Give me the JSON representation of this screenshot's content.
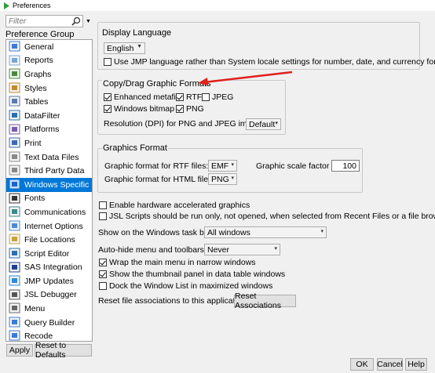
{
  "window": {
    "title": "Preferences"
  },
  "filter": {
    "placeholder": "Filter"
  },
  "left": {
    "group_label": "Preference Group",
    "items": [
      {
        "label": "General",
        "icon": "general-icon"
      },
      {
        "label": "Reports",
        "icon": "reports-icon"
      },
      {
        "label": "Graphs",
        "icon": "graphs-icon"
      },
      {
        "label": "Styles",
        "icon": "styles-icon"
      },
      {
        "label": "Tables",
        "icon": "tables-icon"
      },
      {
        "label": "DataFilter",
        "icon": "datafilter-icon"
      },
      {
        "label": "Platforms",
        "icon": "platforms-icon"
      },
      {
        "label": "Print",
        "icon": "print-icon"
      },
      {
        "label": "Text Data Files",
        "icon": "text-data-files-icon"
      },
      {
        "label": "Third Party Data",
        "icon": "third-party-data-icon"
      },
      {
        "label": "Windows Specific",
        "icon": "windows-specific-icon",
        "selected": true
      },
      {
        "label": "Fonts",
        "icon": "fonts-icon"
      },
      {
        "label": "Communications",
        "icon": "communications-icon"
      },
      {
        "label": "Internet Options",
        "icon": "internet-options-icon"
      },
      {
        "label": "File Locations",
        "icon": "file-locations-icon"
      },
      {
        "label": "Script Editor",
        "icon": "script-editor-icon"
      },
      {
        "label": "SAS Integration",
        "icon": "sas-integration-icon"
      },
      {
        "label": "JMP Updates",
        "icon": "jmp-updates-icon"
      },
      {
        "label": "JSL Debugger",
        "icon": "jsl-debugger-icon"
      },
      {
        "label": "Menu",
        "icon": "menu-icon"
      },
      {
        "label": "Query Builder",
        "icon": "query-builder-icon"
      },
      {
        "label": "Recode",
        "icon": "recode-icon"
      }
    ],
    "apply_label": "Apply",
    "reset_defaults_label": "Reset to Defaults"
  },
  "display_language": {
    "title": "Display Language",
    "selected": "English",
    "use_jmp_language_label": "Use JMP language rather than System locale settings for number, date, and currency formats",
    "use_jmp_language_checked": false
  },
  "copy_drag": {
    "title": "Copy/Drag Graphic Formats",
    "enhanced_metafile": {
      "label": "Enhanced metafile",
      "checked": true
    },
    "rtf": {
      "label": "RTF",
      "checked": true
    },
    "jpeg": {
      "label": "JPEG",
      "checked": false
    },
    "windows_bitmap": {
      "label": "Windows bitmap",
      "checked": true
    },
    "png": {
      "label": "PNG",
      "checked": true
    },
    "resolution_label": "Resolution (DPI) for PNG and JPEG images:",
    "resolution_value": "Default"
  },
  "graphics_format": {
    "title": "Graphics Format",
    "rtf_label": "Graphic format for RTF files:",
    "rtf_value": "EMF",
    "html_label": "Graphic format for HTML files:",
    "html_value": "PNG",
    "scale_label": "Graphic scale factor %",
    "scale_value": "100"
  },
  "options": {
    "hw_accel": {
      "label": "Enable hardware accelerated graphics",
      "checked": false
    },
    "jsl_scripts": {
      "label": "JSL Scripts should be run only, not opened, when selected from Recent Files or a file browser",
      "checked": false
    },
    "taskbar_label": "Show on the Windows task bar:",
    "taskbar_value": "All windows",
    "autohide_label": "Auto-hide menu and toolbars",
    "autohide_value": "Never",
    "wrap_menu": {
      "label": "Wrap the main menu in narrow windows",
      "checked": true
    },
    "thumbnail_panel": {
      "label": "Show the thumbnail panel in data table windows",
      "checked": true
    },
    "dock_window_list": {
      "label": "Dock the Window List in maximized windows",
      "checked": false
    },
    "reset_assoc_label": "Reset file associations to this application.",
    "reset_assoc_button": "Reset Associations"
  },
  "footer": {
    "ok_label": "OK",
    "cancel_label": "Cancel",
    "help_label": "Help"
  },
  "colors": {
    "selection": "#0078d7",
    "annotation_arrow": "#e0201b"
  }
}
